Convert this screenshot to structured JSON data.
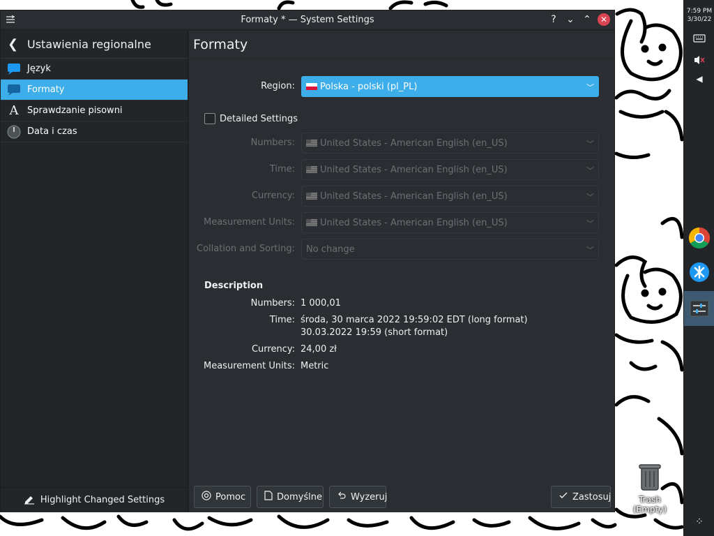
{
  "window": {
    "title": "Formaty * — System Settings",
    "help_glyph": "?",
    "minimize_glyph": "⌄",
    "maximize_glyph": "⌃",
    "close_glyph": "✕"
  },
  "sidebar": {
    "title": "Ustawienia regionalne",
    "items": [
      {
        "label": "Język",
        "icon": "chat-bubble-icon"
      },
      {
        "label": "Formaty",
        "icon": "chat-bubble-icon"
      },
      {
        "label": "Sprawdzanie pisowni",
        "icon": "letter-a-icon"
      },
      {
        "label": "Data i czas",
        "icon": "clock-icon"
      }
    ],
    "selected_index": 1,
    "footer_label": "Highlight Changed Settings"
  },
  "main": {
    "title": "Formaty",
    "region": {
      "label": "Region:",
      "value": "Polska - polski (pl_PL)"
    },
    "detailed_settings_label": "Detailed Settings",
    "detailed_settings_checked": false,
    "fields": [
      {
        "label": "Numbers:",
        "value": "United States - American English (en_US)"
      },
      {
        "label": "Time:",
        "value": "United States - American English (en_US)"
      },
      {
        "label": "Currency:",
        "value": "United States - American English (en_US)"
      },
      {
        "label": "Measurement Units:",
        "value": "United States - American English (en_US)"
      },
      {
        "label": "Collation and Sorting:",
        "value": "No change"
      }
    ],
    "description": {
      "title": "Description",
      "numbers_label": "Numbers:",
      "numbers_value": "1 000,01",
      "time_label": "Time:",
      "time_long": "środa, 30 marca 2022 19:59:02 EDT (long format)",
      "time_short": "30.03.2022 19:59 (short format)",
      "currency_label": "Currency:",
      "currency_value": "24,00 zł",
      "units_label": "Measurement Units:",
      "units_value": "Metric"
    },
    "buttons": {
      "help": "Pomoc",
      "defaults": "Domyślne",
      "reset": "Wyzeruj",
      "apply": "Zastosuj"
    }
  },
  "panel": {
    "time": "7:59 PM",
    "date": "3/30/22"
  },
  "desktop": {
    "trash_label": "Trash (Empty)"
  },
  "colors": {
    "accent": "#3daee9",
    "window_bg": "#2a2e32",
    "sidebar_bg": "#232629",
    "close": "#da4453"
  }
}
